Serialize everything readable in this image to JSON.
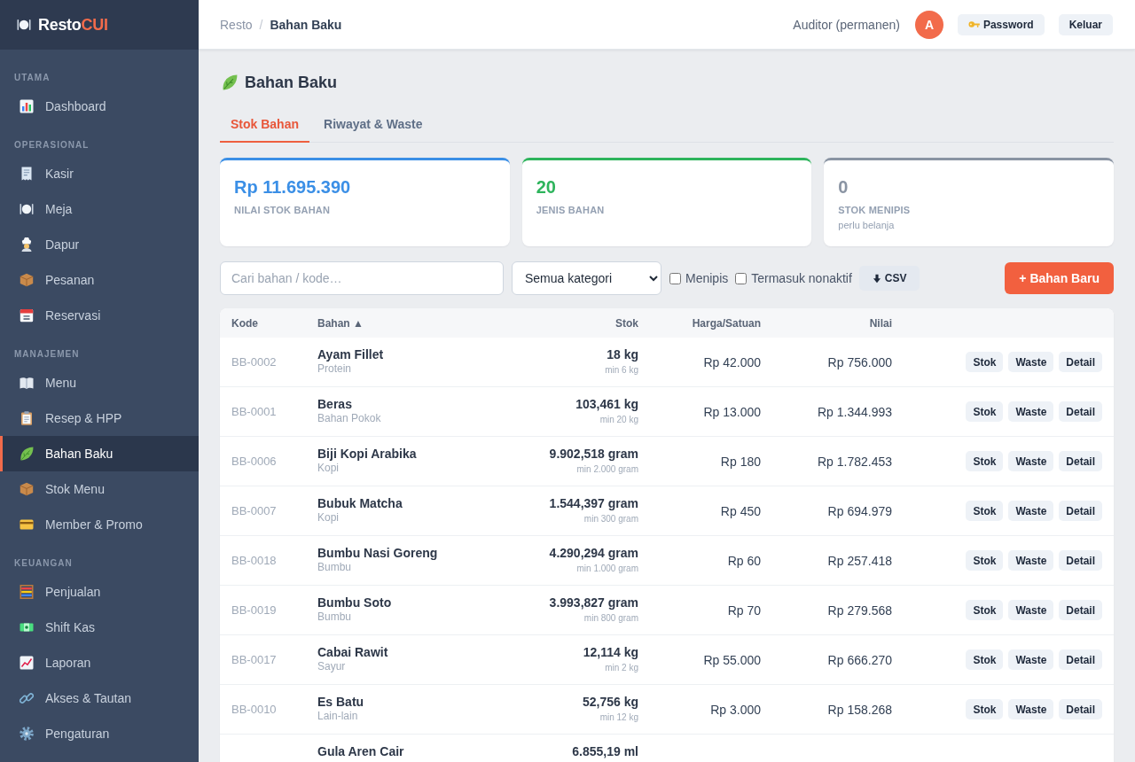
{
  "sidebar": {
    "logo": {
      "text": "Resto",
      "accent": "CUI"
    },
    "sections": [
      {
        "title": "UTAMA",
        "items": [
          {
            "label": "Dashboard",
            "selected": false
          }
        ]
      },
      {
        "title": "OPERASIONAL",
        "items": [
          {
            "label": "Kasir",
            "selected": false
          },
          {
            "label": "Meja",
            "selected": false
          },
          {
            "label": "Dapur",
            "selected": false
          },
          {
            "label": "Pesanan",
            "selected": false
          },
          {
            "label": "Reservasi",
            "selected": false
          }
        ]
      },
      {
        "title": "MANAJEMEN",
        "items": [
          {
            "label": "Menu",
            "selected": false
          },
          {
            "label": "Resep & HPP",
            "selected": false
          },
          {
            "label": "Bahan Baku",
            "selected": true
          },
          {
            "label": "Stok Menu",
            "selected": false
          },
          {
            "label": "Member & Promo",
            "selected": false
          }
        ]
      },
      {
        "title": "KEUANGAN",
        "items": [
          {
            "label": "Penjualan",
            "selected": false
          },
          {
            "label": "Shift Kas",
            "selected": false
          },
          {
            "label": "Laporan",
            "selected": false
          },
          {
            "label": "Akses & Tautan",
            "selected": false
          },
          {
            "label": "Pengaturan",
            "selected": false
          }
        ]
      }
    ]
  },
  "header": {
    "breadcrumb": {
      "parent": "Resto",
      "separator": "/",
      "current": "Bahan Baku"
    },
    "user": "Auditor (permanen)",
    "avatar": "A",
    "buttons": [
      "Password",
      "Keluar"
    ]
  },
  "page": {
    "title": "Bahan Baku"
  },
  "tabs": [
    {
      "label": "Stok Bahan",
      "selected": true
    },
    {
      "label": "Riwayat & Waste",
      "selected": false
    }
  ],
  "stats": [
    {
      "value": "Rp 11.695.390",
      "label": "NILAI STOK BAHAN",
      "color": "#3b8fe6"
    },
    {
      "value": "20",
      "label": "JENIS BAHAN",
      "color": "#2eb45c"
    },
    {
      "value": "0",
      "label": "STOK MENIPIS",
      "note": "perlu belanja",
      "color": "#8a94a3"
    }
  ],
  "filters": {
    "search": {
      "placeholder": "Cari bahan / kode…"
    },
    "category": {
      "value": "Semua kategori"
    },
    "checkboxes": [
      {
        "label": "Menipis",
        "checked": false
      },
      {
        "label": "Termasuk nonaktif",
        "checked": false
      }
    ],
    "export_button": "CSV",
    "add_button": "+ Bahan Baru"
  },
  "table": {
    "columns": [
      "Kode",
      "Bahan ▲",
      "Stok",
      "Harga/Satuan",
      "Nilai"
    ],
    "rows": [
      {
        "code": "BB-0002",
        "name": "Ayam Fillet",
        "category": "Protein",
        "stock": "18 kg",
        "minimum": "min 6 kg",
        "price": "Rp 42.000",
        "value": "Rp 756.000",
        "actions": [
          "Stok",
          "Waste",
          "Detail"
        ]
      },
      {
        "code": "BB-0001",
        "name": "Beras",
        "category": "Bahan Pokok",
        "stock": "103,461 kg",
        "minimum": "min 20 kg",
        "price": "Rp 13.000",
        "value": "Rp 1.344.993",
        "actions": [
          "Stok",
          "Waste",
          "Detail"
        ]
      },
      {
        "code": "BB-0006",
        "name": "Biji Kopi Arabika",
        "category": "Kopi",
        "stock": "9.902,518 gram",
        "minimum": "min 2.000 gram",
        "price": "Rp 180",
        "value": "Rp 1.782.453",
        "actions": [
          "Stok",
          "Waste",
          "Detail"
        ]
      },
      {
        "code": "BB-0007",
        "name": "Bubuk Matcha",
        "category": "Kopi",
        "stock": "1.544,397 gram",
        "minimum": "min 300 gram",
        "price": "Rp 450",
        "value": "Rp 694.979",
        "actions": [
          "Stok",
          "Waste",
          "Detail"
        ]
      },
      {
        "code": "BB-0018",
        "name": "Bumbu Nasi Goreng",
        "category": "Bumbu",
        "stock": "4.290,294 gram",
        "minimum": "min 1.000 gram",
        "price": "Rp 60",
        "value": "Rp 257.418",
        "actions": [
          "Stok",
          "Waste",
          "Detail"
        ]
      },
      {
        "code": "BB-0019",
        "name": "Bumbu Soto",
        "category": "Bumbu",
        "stock": "3.993,827 gram",
        "minimum": "min 800 gram",
        "price": "Rp 70",
        "value": "Rp 279.568",
        "actions": [
          "Stok",
          "Waste",
          "Detail"
        ]
      },
      {
        "code": "BB-0017",
        "name": "Cabai Rawit",
        "category": "Sayur",
        "stock": "12,114 kg",
        "minimum": "min 2 kg",
        "price": "Rp 55.000",
        "value": "Rp 666.270",
        "actions": [
          "Stok",
          "Waste",
          "Detail"
        ]
      },
      {
        "code": "BB-0010",
        "name": "Es Batu",
        "category": "Lain-lain",
        "stock": "52,756 kg",
        "minimum": "min 12 kg",
        "price": "Rp 3.000",
        "value": "Rp 158.268",
        "actions": [
          "Stok",
          "Waste",
          "Detail"
        ]
      },
      {
        "name": "Gula Aren Cair",
        "stock": "6.855,19 ml"
      }
    ]
  }
}
